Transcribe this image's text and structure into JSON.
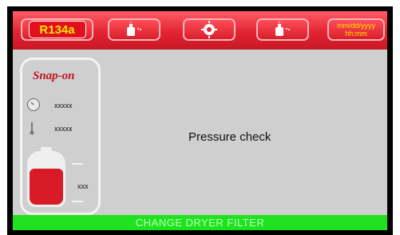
{
  "header": {
    "refrigerant": "R134a",
    "datetime_line1": "mm/dd/yyyy",
    "datetime_line2": "hh:mm",
    "icons": [
      "tank-valve-icon",
      "fan-icon",
      "tank-valve-icon"
    ]
  },
  "side_panel": {
    "brand": "Snap-on",
    "pressure_value": "xxxxx",
    "temperature_value": "xxxxx",
    "tank_value": "xxx",
    "tank_fill_fraction": 0.7
  },
  "main": {
    "message": "Pressure check"
  },
  "status": {
    "text": "CHANGE DRYER FILTER"
  },
  "colors": {
    "header_red": "#e32332",
    "text_yellow": "#ffe400",
    "status_green": "#1ee31e",
    "screen_gray": "#cfcfcf"
  }
}
